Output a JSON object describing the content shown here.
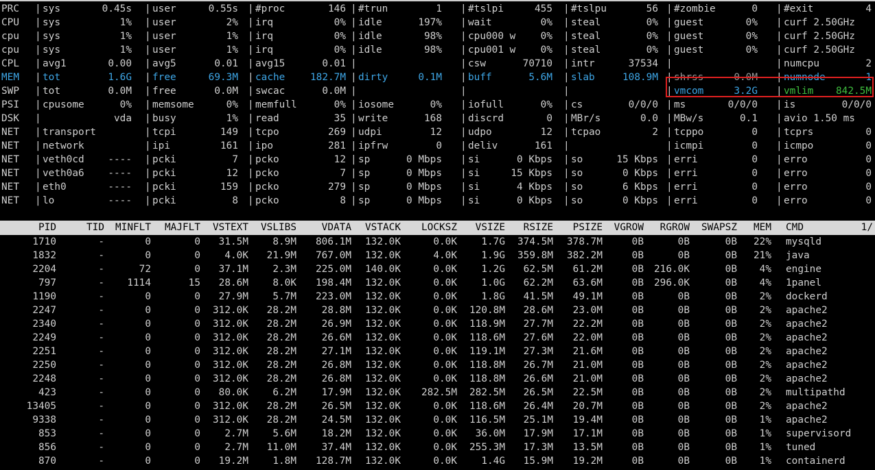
{
  "system_rows": [
    {
      "label": "PRC",
      "cells": [
        [
          "sys",
          "0.45s"
        ],
        [
          "user",
          "0.55s"
        ],
        [
          "#proc",
          "146"
        ],
        [
          "#trun",
          "1"
        ],
        [
          "#tslpi",
          "455"
        ],
        [
          "#tslpu",
          "56"
        ],
        [
          "#zombie",
          "0"
        ],
        [
          "#exit",
          "4"
        ]
      ]
    },
    {
      "label": "CPU",
      "cells": [
        [
          "sys",
          "1%"
        ],
        [
          "user",
          "2%"
        ],
        [
          "irq",
          "0%"
        ],
        [
          "idle",
          "197%"
        ],
        [
          "wait",
          "0%"
        ],
        [
          "steal",
          "0%"
        ],
        [
          "guest",
          "0%"
        ],
        [
          "curf 2.50GHz",
          ""
        ]
      ]
    },
    {
      "label": "cpu",
      "cells": [
        [
          "sys",
          "1%"
        ],
        [
          "user",
          "1%"
        ],
        [
          "irq",
          "0%"
        ],
        [
          "idle",
          "98%"
        ],
        [
          "cpu000 w",
          "0%"
        ],
        [
          "steal",
          "0%"
        ],
        [
          "guest",
          "0%"
        ],
        [
          "curf 2.50GHz",
          ""
        ]
      ]
    },
    {
      "label": "cpu",
      "cells": [
        [
          "sys",
          "1%"
        ],
        [
          "user",
          "1%"
        ],
        [
          "irq",
          "0%"
        ],
        [
          "idle",
          "98%"
        ],
        [
          "cpu001 w",
          "0%"
        ],
        [
          "steal",
          "0%"
        ],
        [
          "guest",
          "0%"
        ],
        [
          "curf 2.50GHz",
          ""
        ]
      ]
    },
    {
      "label": "CPL",
      "cells": [
        [
          "avg1",
          "0.00"
        ],
        [
          "avg5",
          "0.01"
        ],
        [
          "avg15",
          "0.01"
        ],
        [
          "",
          ""
        ],
        [
          "csw",
          "70710"
        ],
        [
          "intr",
          "37534"
        ],
        [
          "",
          ""
        ],
        [
          "numcpu",
          "2"
        ]
      ]
    },
    {
      "label": "MEM",
      "mem": true,
      "cells": [
        [
          "tot",
          "1.6G"
        ],
        [
          "free",
          "69.3M"
        ],
        [
          "cache",
          "182.7M"
        ],
        [
          "dirty",
          "0.1M"
        ],
        [
          "buff",
          "5.6M"
        ],
        [
          "slab",
          "108.9M"
        ],
        [
          "shrss",
          "0.0M"
        ],
        [
          "numnode",
          "1"
        ]
      ]
    },
    {
      "label": "SWP",
      "cells": [
        [
          "tot",
          "0.0M"
        ],
        [
          "free",
          "0.0M"
        ],
        [
          "swcac",
          "0.0M"
        ],
        [
          "",
          ""
        ],
        [
          "",
          ""
        ],
        [
          "",
          ""
        ],
        [
          "vmcom",
          "3.2G"
        ],
        [
          "vmlim",
          "842.5M"
        ]
      ]
    },
    {
      "label": "PSI",
      "cells": [
        [
          "cpusome",
          "0%"
        ],
        [
          "memsome",
          "0%"
        ],
        [
          "memfull",
          "0%"
        ],
        [
          "iosome",
          "0%"
        ],
        [
          "iofull",
          "0%"
        ],
        [
          "cs",
          "0/0/0"
        ],
        [
          "ms",
          "0/0/0"
        ],
        [
          "is",
          "0/0/0"
        ]
      ]
    },
    {
      "label": "DSK",
      "cells": [
        [
          "",
          "vda"
        ],
        [
          "busy",
          "1%"
        ],
        [
          "read",
          "35"
        ],
        [
          "write",
          "168"
        ],
        [
          "discrd",
          "0"
        ],
        [
          "MBr/s",
          "0.0"
        ],
        [
          "MBw/s",
          "0.1"
        ],
        [
          "avio 1.50 ms",
          ""
        ]
      ]
    },
    {
      "label": "NET",
      "cells": [
        [
          "transport",
          ""
        ],
        [
          "tcpi",
          "149"
        ],
        [
          "tcpo",
          "269"
        ],
        [
          "udpi",
          "12"
        ],
        [
          "udpo",
          "12"
        ],
        [
          "tcpao",
          "2"
        ],
        [
          "tcppo",
          "0"
        ],
        [
          "tcprs",
          "0"
        ]
      ]
    },
    {
      "label": "NET",
      "cells": [
        [
          "network",
          ""
        ],
        [
          "ipi",
          "161"
        ],
        [
          "ipo",
          "281"
        ],
        [
          "ipfrw",
          "0"
        ],
        [
          "deliv",
          "161"
        ],
        [
          "",
          ""
        ],
        [
          "icmpi",
          "0"
        ],
        [
          "icmpo",
          "0"
        ]
      ]
    },
    {
      "label": "NET",
      "cells": [
        [
          "veth0cd",
          "----"
        ],
        [
          "pcki",
          "7"
        ],
        [
          "pcko",
          "12"
        ],
        [
          "sp",
          "0 Mbps"
        ],
        [
          "si",
          "0 Kbps"
        ],
        [
          "so",
          "15 Kbps"
        ],
        [
          "erri",
          "0"
        ],
        [
          "erro",
          "0"
        ]
      ]
    },
    {
      "label": "NET",
      "cells": [
        [
          "veth0a6",
          "----"
        ],
        [
          "pcki",
          "12"
        ],
        [
          "pcko",
          "7"
        ],
        [
          "sp",
          "0 Mbps"
        ],
        [
          "si",
          "15 Kbps"
        ],
        [
          "so",
          "0 Kbps"
        ],
        [
          "erri",
          "0"
        ],
        [
          "erro",
          "0"
        ]
      ]
    },
    {
      "label": "NET",
      "cells": [
        [
          "eth0",
          "----"
        ],
        [
          "pcki",
          "159"
        ],
        [
          "pcko",
          "279"
        ],
        [
          "sp",
          "0 Mbps"
        ],
        [
          "si",
          "4 Kbps"
        ],
        [
          "so",
          "6 Kbps"
        ],
        [
          "erri",
          "0"
        ],
        [
          "erro",
          "0"
        ]
      ]
    },
    {
      "label": "NET",
      "cells": [
        [
          "lo",
          "----"
        ],
        [
          "pcki",
          "8"
        ],
        [
          "pcko",
          "8"
        ],
        [
          "sp",
          "0 Mbps"
        ],
        [
          "si",
          "0 Kbps"
        ],
        [
          "so",
          "0 Kbps"
        ],
        [
          "erri",
          "0"
        ],
        [
          "erro",
          "0"
        ]
      ]
    }
  ],
  "process_header": [
    "PID",
    "TID",
    "MINFLT",
    "MAJFLT",
    "VSTEXT",
    "VSLIBS",
    "VDATA",
    "VSTACK",
    "LOCKSZ",
    "VSIZE",
    "RSIZE",
    "PSIZE",
    "VGROW",
    "RGROW",
    "SWAPSZ",
    "MEM",
    "CMD"
  ],
  "page_indicator": "1/",
  "processes": [
    [
      "1710",
      "-",
      "0",
      "0",
      "31.5M",
      "8.9M",
      "806.1M",
      "132.0K",
      "0.0K",
      "1.7G",
      "374.5M",
      "378.7M",
      "0B",
      "0B",
      "0B",
      "22%",
      "mysqld"
    ],
    [
      "1832",
      "-",
      "0",
      "0",
      "4.0K",
      "21.9M",
      "767.0M",
      "132.0K",
      "4.0K",
      "1.9G",
      "359.8M",
      "382.2M",
      "0B",
      "0B",
      "0B",
      "21%",
      "java"
    ],
    [
      "2204",
      "-",
      "72",
      "0",
      "37.1M",
      "2.3M",
      "225.0M",
      "140.0K",
      "0.0K",
      "1.2G",
      "62.5M",
      "61.2M",
      "0B",
      "216.0K",
      "0B",
      "4%",
      "engine"
    ],
    [
      "797",
      "-",
      "1114",
      "15",
      "28.6M",
      "8.0K",
      "198.4M",
      "132.0K",
      "0.0K",
      "1.0G",
      "62.2M",
      "63.6M",
      "0B",
      "296.0K",
      "0B",
      "4%",
      "1panel"
    ],
    [
      "1190",
      "-",
      "0",
      "0",
      "27.9M",
      "5.7M",
      "223.0M",
      "132.0K",
      "0.0K",
      "1.8G",
      "41.5M",
      "49.1M",
      "0B",
      "0B",
      "0B",
      "2%",
      "dockerd"
    ],
    [
      "2247",
      "-",
      "0",
      "0",
      "312.0K",
      "28.2M",
      "28.8M",
      "132.0K",
      "0.0K",
      "120.8M",
      "28.6M",
      "23.0M",
      "0B",
      "0B",
      "0B",
      "2%",
      "apache2"
    ],
    [
      "2340",
      "-",
      "0",
      "0",
      "312.0K",
      "28.2M",
      "26.9M",
      "132.0K",
      "0.0K",
      "118.9M",
      "27.7M",
      "22.2M",
      "0B",
      "0B",
      "0B",
      "2%",
      "apache2"
    ],
    [
      "2249",
      "-",
      "0",
      "0",
      "312.0K",
      "28.2M",
      "26.6M",
      "132.0K",
      "0.0K",
      "118.6M",
      "27.6M",
      "22.0M",
      "0B",
      "0B",
      "0B",
      "2%",
      "apache2"
    ],
    [
      "2251",
      "-",
      "0",
      "0",
      "312.0K",
      "28.2M",
      "27.1M",
      "132.0K",
      "0.0K",
      "119.1M",
      "27.3M",
      "21.6M",
      "0B",
      "0B",
      "0B",
      "2%",
      "apache2"
    ],
    [
      "2250",
      "-",
      "0",
      "0",
      "312.0K",
      "28.2M",
      "26.8M",
      "132.0K",
      "0.0K",
      "118.8M",
      "26.7M",
      "21.0M",
      "0B",
      "0B",
      "0B",
      "2%",
      "apache2"
    ],
    [
      "2248",
      "-",
      "0",
      "0",
      "312.0K",
      "28.2M",
      "26.8M",
      "132.0K",
      "0.0K",
      "118.8M",
      "26.6M",
      "21.0M",
      "0B",
      "0B",
      "0B",
      "2%",
      "apache2"
    ],
    [
      "423",
      "-",
      "0",
      "0",
      "80.0K",
      "6.2M",
      "17.9M",
      "132.0K",
      "282.5M",
      "282.5M",
      "26.5M",
      "22.5M",
      "0B",
      "0B",
      "0B",
      "2%",
      "multipathd"
    ],
    [
      "13405",
      "-",
      "0",
      "0",
      "312.0K",
      "28.2M",
      "26.5M",
      "132.0K",
      "0.0K",
      "118.6M",
      "26.4M",
      "20.7M",
      "0B",
      "0B",
      "0B",
      "2%",
      "apache2"
    ],
    [
      "9338",
      "-",
      "0",
      "0",
      "312.0K",
      "28.2M",
      "24.5M",
      "132.0K",
      "0.0K",
      "116.5M",
      "25.1M",
      "19.4M",
      "0B",
      "0B",
      "0B",
      "1%",
      "apache2"
    ],
    [
      "853",
      "-",
      "0",
      "0",
      "2.7M",
      "5.6M",
      "18.2M",
      "132.0K",
      "0.0K",
      "36.0M",
      "17.9M",
      "17.1M",
      "0B",
      "0B",
      "0B",
      "1%",
      "supervisord"
    ],
    [
      "856",
      "-",
      "0",
      "0",
      "2.7M",
      "11.0M",
      "37.4M",
      "132.0K",
      "0.0K",
      "255.3M",
      "17.3M",
      "13.5M",
      "0B",
      "0B",
      "0B",
      "1%",
      "tuned"
    ],
    [
      "870",
      "-",
      "0",
      "0",
      "19.2M",
      "1.8M",
      "128.7M",
      "132.0K",
      "0.0K",
      "1.4G",
      "15.9M",
      "19.2M",
      "0B",
      "0B",
      "0B",
      "1%",
      "containerd"
    ]
  ]
}
